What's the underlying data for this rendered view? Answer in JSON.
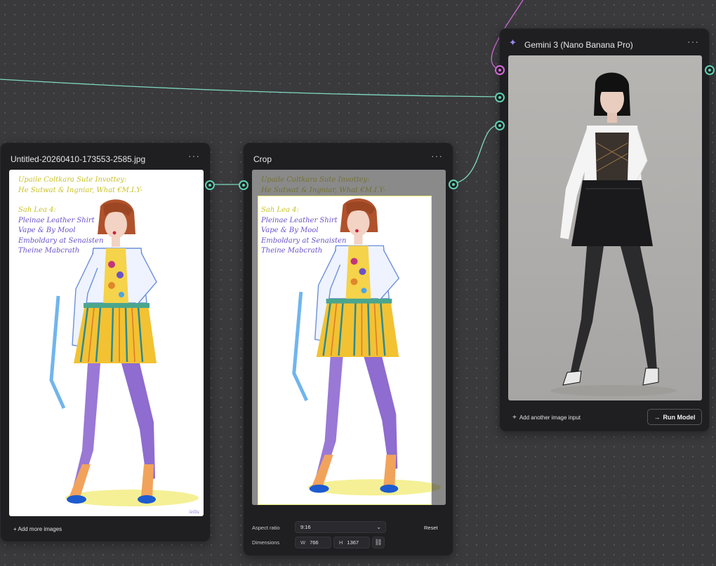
{
  "canvas": {
    "background": "#3a3a3d",
    "wire_color": "#7fd9c0",
    "pink_wire_color": "#d36ad8"
  },
  "image_node": {
    "title": "Untitled-20260410-173553-2585.jpg",
    "menu_icon": "more-horizontal-icon",
    "add_more_label": "+ Add more images"
  },
  "crop_node": {
    "title": "Crop",
    "menu_icon": "more-horizontal-icon",
    "aspect_ratio_label": "Aspect ratio",
    "aspect_ratio_value": "9:16",
    "dimensions_label": "Dimensions",
    "width_prefix": "W",
    "width_value": "766",
    "height_prefix": "H",
    "height_value": "1367",
    "reset_label": "Reset",
    "link_icon": "link-icon"
  },
  "gemini_node": {
    "title": "Gemini 3 (Nano Banana Pro)",
    "icon": "sparkle-icon",
    "menu_icon": "more-horizontal-icon",
    "add_input_label": "Add another image input",
    "run_label": "Run Model"
  },
  "sketch": {
    "lines": [
      "Upaile Coltkara Sute Invottey:",
      "He Sutwat & Ingniar, What €M.I.Y-",
      "",
      "Sah Lea 4:",
      "Pleinae Leather Shirt",
      "Vape & By Mool",
      "Emboldary at Senaisten",
      "Theine Mabcrath"
    ],
    "signature": "lellis"
  }
}
